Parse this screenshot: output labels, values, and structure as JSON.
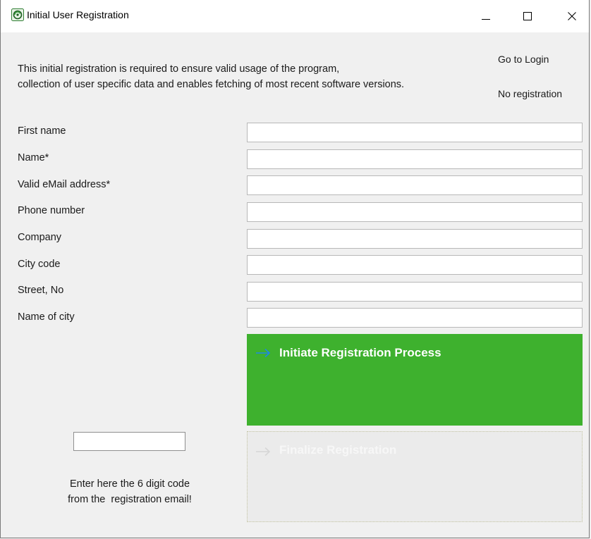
{
  "window": {
    "title": "Initial User Registration",
    "icon": "registration-app-icon",
    "controls": {
      "minimize": "minimize-icon",
      "maximize": "maximize-icon",
      "close": "close-icon"
    }
  },
  "intro": {
    "line1": "This initial registration is required to ensure valid usage of the program,",
    "line2": "collection of user specific data and enables fetching of most recent software versions."
  },
  "links": {
    "go_to_login": "Go to Login",
    "no_registration": "No registration"
  },
  "form": {
    "fields": [
      {
        "label": "First name",
        "value": ""
      },
      {
        "label": "Name*",
        "value": ""
      },
      {
        "label": "Valid eMail address*",
        "value": ""
      },
      {
        "label": "Phone number",
        "value": ""
      },
      {
        "label": "Company",
        "value": ""
      },
      {
        "label": "City code",
        "value": ""
      },
      {
        "label": "Street, No",
        "value": ""
      },
      {
        "label": "Name of city",
        "value": ""
      }
    ]
  },
  "actions": {
    "initiate": {
      "label": "Initiate Registration Process",
      "icon": "arrow-right-icon",
      "color": "#3eb12e",
      "arrow_color": "#1e88e5"
    },
    "finalize": {
      "label": "Finalize Registration",
      "icon": "arrow-right-icon",
      "color": "#ebebeb",
      "enabled": false
    }
  },
  "code": {
    "value": "",
    "hint_line1": "Enter here the 6 digit code",
    "hint_line2": "from the  registration email!"
  }
}
